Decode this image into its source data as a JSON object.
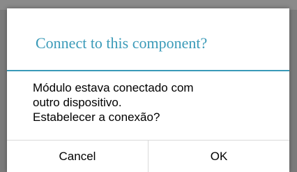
{
  "dialog": {
    "title": "Connect to this component?",
    "message_lines": [
      "Módulo estava conectado com",
      "outro dispositivo.",
      "Estabelecer a conexão?"
    ],
    "buttons": {
      "cancel_label": "Cancel",
      "ok_label": "OK"
    },
    "accent_color": "#3a9ab8"
  }
}
